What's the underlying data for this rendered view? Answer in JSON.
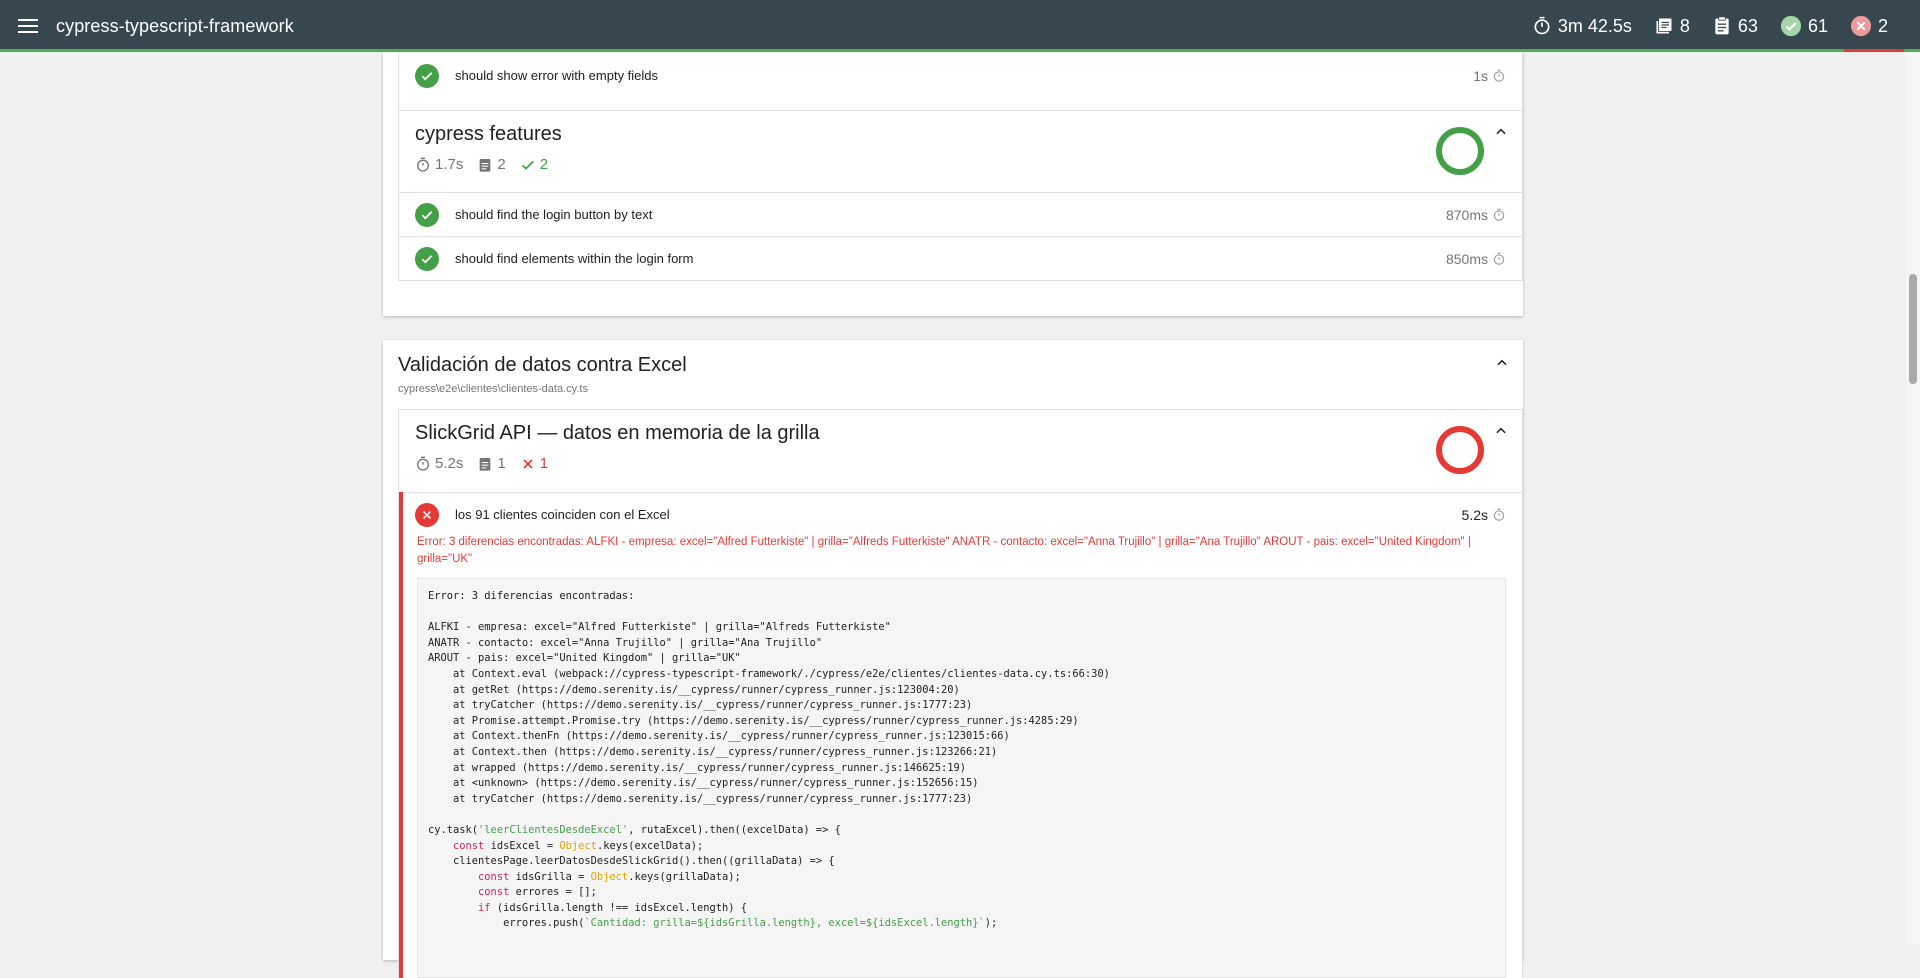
{
  "topbar": {
    "title": "cypress-typescript-framework",
    "stats": {
      "duration": "3m 42.5s",
      "suites": "8",
      "tests": "63",
      "passed": "61",
      "failed": "2"
    }
  },
  "prev_test": {
    "name": "should show error with empty fields",
    "duration": "1s"
  },
  "cypress_features": {
    "title": "cypress features",
    "duration": "1.7s",
    "tests": "2",
    "passed": "2",
    "items": [
      {
        "name": "should find the login button by text",
        "duration": "870ms"
      },
      {
        "name": "should find elements within the login form",
        "duration": "850ms"
      }
    ]
  },
  "excel_file": {
    "title": "Validación de datos contra Excel",
    "path": "cypress\\e2e\\clientes\\clientes-data.cy.ts"
  },
  "slickgrid_suite": {
    "title": "SlickGrid API — datos en memoria de la grilla",
    "duration": "5.2s",
    "tests": "1",
    "failed": "1",
    "test": {
      "name": "los 91 clientes coinciden con el Excel",
      "duration": "5.2s"
    },
    "error_message": "Error: 3 diferencias encontradas: ALFKI - empresa: excel=\"Alfred Futterkiste\" | grilla=\"Alfreds Futterkiste\" ANATR - contacto: excel=\"Anna Trujillo\" | grilla=\"Ana Trujillo\" AROUT - pais: excel=\"United Kingdom\" | grilla=\"UK\"",
    "stack": "Error: 3 diferencias encontradas:\n\nALFKI - empresa: excel=\"Alfred Futterkiste\" | grilla=\"Alfreds Futterkiste\"\nANATR - contacto: excel=\"Anna Trujillo\" | grilla=\"Ana Trujillo\"\nAROUT - pais: excel=\"United Kingdom\" | grilla=\"UK\"\n    at Context.eval (webpack://cypress-typescript-framework/./cypress/e2e/clientes/clientes-data.cy.ts:66:30)\n    at getRet (https://demo.serenity.is/__cypress/runner/cypress_runner.js:123004:20)\n    at tryCatcher (https://demo.serenity.is/__cypress/runner/cypress_runner.js:1777:23)\n    at Promise.attempt.Promise.try (https://demo.serenity.is/__cypress/runner/cypress_runner.js:4285:29)\n    at Context.thenFn (https://demo.serenity.is/__cypress/runner/cypress_runner.js:123015:66)\n    at Context.then (https://demo.serenity.is/__cypress/runner/cypress_runner.js:123266:21)\n    at wrapped (https://demo.serenity.is/__cypress/runner/cypress_runner.js:146625:19)\n    at <unknown> (https://demo.serenity.is/__cypress/runner/cypress_runner.js:152656:15)\n    at tryCatcher (https://demo.serenity.is/__cypress/runner/cypress_runner.js:1777:23)",
    "code_lines": [
      "cy.task('leerClientesDesdeExcel', rutaExcel).then((excelData) => {",
      "    const idsExcel = Object.keys(excelData);",
      "    clientesPage.leerDatosDesdeSlickGrid().then((grillaData) => {",
      "        const idsGrilla = Object.keys(grillaData);",
      "        const errores = [];",
      "        if (idsGrilla.length !== idsExcel.length) {",
      "            errores.push(`Cantidad: grilla=${idsGrilla.length}, excel=${idsExcel.length}`);"
    ]
  },
  "colors": {
    "pass": "#43a047",
    "fail": "#e53935",
    "topbar": "#37474f"
  }
}
